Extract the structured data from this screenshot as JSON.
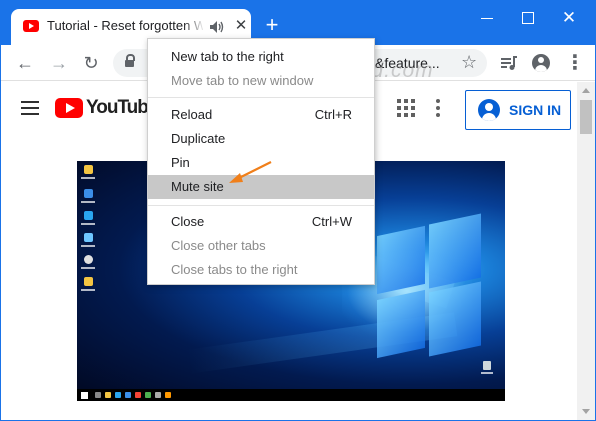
{
  "browser": {
    "tab": {
      "title": "Tutorial - Reset forgotten Wi",
      "close_label": "✕"
    },
    "new_tab_label": "+",
    "window_controls": {
      "close_label": "✕"
    },
    "toolbar": {
      "back_label": "←",
      "forward_label": "→",
      "reload_label": "↻",
      "url_visible": "&feature...",
      "star_label": "☆",
      "menu_label": "⋮"
    }
  },
  "youtube": {
    "logo_text": "YouTube",
    "signin_label": "SIGN IN"
  },
  "watermark": "Top-password.com",
  "context_menu": {
    "items": [
      {
        "label": "New tab to the right",
        "shortcut": "",
        "disabled": false
      },
      {
        "label": "Move tab to new window",
        "shortcut": "",
        "disabled": true
      },
      {
        "label": "Reload",
        "shortcut": "Ctrl+R",
        "disabled": false
      },
      {
        "label": "Duplicate",
        "shortcut": "",
        "disabled": false
      },
      {
        "label": "Pin",
        "shortcut": "",
        "disabled": false
      },
      {
        "label": "Mute site",
        "shortcut": "",
        "disabled": false,
        "highlighted": true
      },
      {
        "label": "Close",
        "shortcut": "Ctrl+W",
        "disabled": false
      },
      {
        "label": "Close other tabs",
        "shortcut": "",
        "disabled": true
      },
      {
        "label": "Close tabs to the right",
        "shortcut": "",
        "disabled": true
      }
    ]
  },
  "colors": {
    "chrome_blue": "#1a73e8",
    "youtube_red": "#ff0000",
    "signin_blue": "#065fd4",
    "menu_highlight": "#c8c8c8",
    "arrow_orange": "#f07f1a"
  }
}
